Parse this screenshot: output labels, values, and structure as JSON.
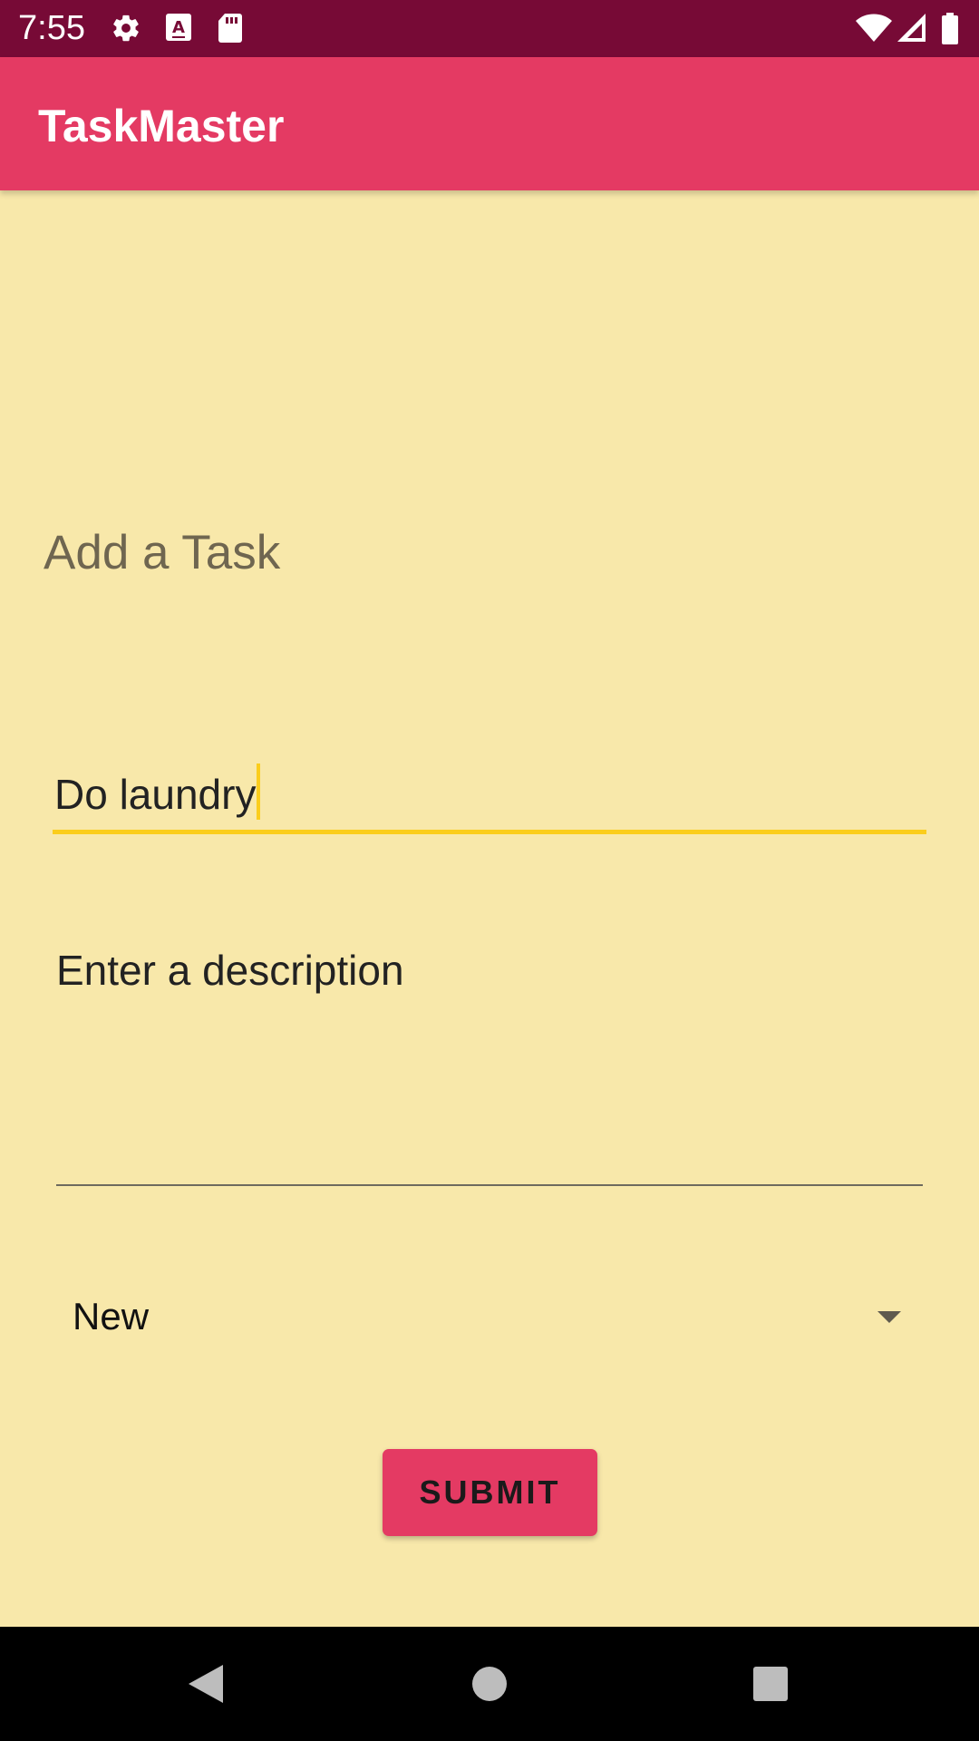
{
  "status_bar": {
    "time": "7:55",
    "icons": [
      "gear-icon",
      "keyboard-a-icon",
      "sd-card-icon",
      "wifi-icon",
      "cell-signal-icon",
      "battery-icon"
    ]
  },
  "app_bar": {
    "title": "TaskMaster"
  },
  "form": {
    "heading": "Add a Task",
    "title_input": {
      "value": "Do laundry"
    },
    "description_input": {
      "placeholder": "Enter a description"
    },
    "status_select": {
      "selected": "New"
    },
    "submit_label": "SUBMIT"
  },
  "nav_bar": {
    "buttons": [
      "back-icon",
      "home-icon",
      "recents-icon"
    ]
  },
  "colors": {
    "status_bar": "#770A36",
    "app_bar": "#E43A63",
    "background": "#F8E8AA",
    "focus_accent": "#FBCD1C",
    "button": "#E43A63"
  }
}
